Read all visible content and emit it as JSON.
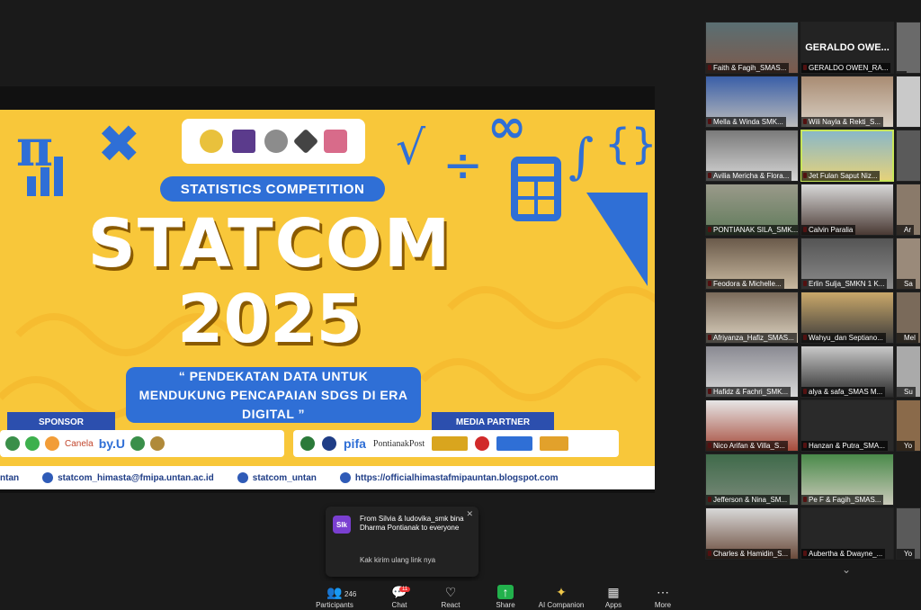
{
  "slide": {
    "competition_label": "STATISTICS COMPETITION",
    "title_line1": "STATCOM",
    "title_line2": "2025",
    "quote": "“ PENDEKATAN DATA UNTUK MENDUKUNG PENCAPAIAN SDGS DI ERA DIGITAL ”",
    "sponsor_tag": "SPONSOR",
    "media_tag": "MEDIA PARTNER",
    "sponsor_names": [
      "Canela",
      "by.U"
    ],
    "media_names": [
      "pifa",
      "PontianakPost"
    ],
    "contacts": [
      {
        "text": "ntan"
      },
      {
        "text": "statcom_himasta@fmipa.untan.ac.id"
      },
      {
        "text": "statcom_untan"
      },
      {
        "text": "https://officialhimastafmipauntan.blogspot.com"
      }
    ],
    "colors": {
      "background": "#f8c73a",
      "accent": "#2f6fd6"
    }
  },
  "gallery": {
    "active_speaker_big_name": "GERALDO OWE...",
    "tiles": [
      {
        "name": "Faith & Fagih_SMAS..."
      },
      {
        "name": "GERALDO OWEN_RA..."
      },
      {
        "name": "Mella & Winda SMK..."
      },
      {
        "name": "Wili Nayla & Rekti_S..."
      },
      {
        "name": "Avilia Mericha & Flora..."
      },
      {
        "name": "Jet Fulan Saput Niz..."
      },
      {
        "name": "PONTIANAK SILA_SMK..."
      },
      {
        "name": "Calvin Paralia"
      },
      {
        "name": "Feodora & Michelle..."
      },
      {
        "name": "Erlin Sulja_SMKN 1 K..."
      },
      {
        "name": "Afriyanza_Hafiz_SMAS..."
      },
      {
        "name": "Wahyu_dan Septiano..."
      },
      {
        "name": "Hafidz & Fachri_SMK..."
      },
      {
        "name": "alya & safa_SMAS M..."
      },
      {
        "name": "Nico Arifan & Villa_S..."
      },
      {
        "name": "Hanzan & Putra_SMA..."
      },
      {
        "name": "Jefferson & Nina_SM..."
      },
      {
        "name": "Pe F & Fagih_SMAS..."
      },
      {
        "name": "Charles & Hamidin_S..."
      },
      {
        "name": "Aubertha & Dwayne_..."
      }
    ],
    "edge_names": [
      "",
      "Ar",
      "Sa",
      "Mel",
      "Su",
      "Yo",
      "Yo"
    ]
  },
  "chat_toast": {
    "avatar": "SIk",
    "from": "From Silvia & ludovika_smk bina Dharma Pontianak to everyone",
    "body": "Kak kirim ulang link nya"
  },
  "toolbar": {
    "participants_count": "246",
    "chat_badge": "11",
    "items": [
      {
        "label": "Participants"
      },
      {
        "label": "Chat"
      },
      {
        "label": "React"
      },
      {
        "label": "Share"
      },
      {
        "label": "AI Companion"
      },
      {
        "label": "Apps"
      },
      {
        "label": "More"
      }
    ]
  }
}
